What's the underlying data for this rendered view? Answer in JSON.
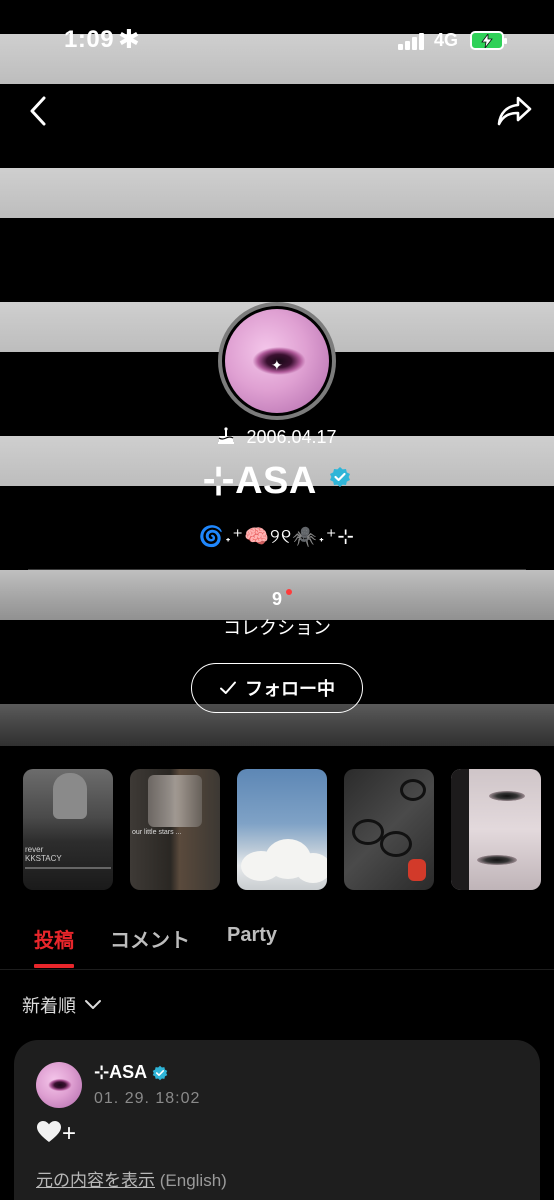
{
  "status_bar": {
    "time": "1:09",
    "indicator": "✱",
    "network": "4G",
    "battery_state": "charging"
  },
  "nav": {
    "back_icon": "chevron-left-icon",
    "share_icon": "share-arrow-icon"
  },
  "profile": {
    "birthday": "2006.04.17",
    "name": "⊹ASA",
    "verified": true,
    "bio_emoji": "🌀˖⁺🧠୨୧🕷️˖⁺⊹",
    "stats": [
      {
        "count": "9",
        "label": "コレクション",
        "new_indicator": true
      }
    ],
    "follow_button": "フォロー中"
  },
  "thumbnails": [
    {
      "caption": "rever\nKKSTACY"
    },
    {
      "caption": "our little stars ..."
    },
    {
      "caption": ""
    },
    {
      "caption": ""
    },
    {
      "caption": ""
    }
  ],
  "tabs": [
    {
      "label": "投稿",
      "active": true
    },
    {
      "label": "コメント",
      "active": false
    },
    {
      "label": "Party",
      "active": false
    }
  ],
  "sort": {
    "label": "新着順"
  },
  "post": {
    "author": "⊹ASA",
    "verified": true,
    "timestamp": "01. 29. 18:02",
    "content": "+",
    "translate_link": "元の内容を表示",
    "translate_lang": "(English)"
  },
  "colors": {
    "accent": "#e8262b",
    "verified": "#2fb5d8",
    "card_bg": "#1e1e1e"
  }
}
